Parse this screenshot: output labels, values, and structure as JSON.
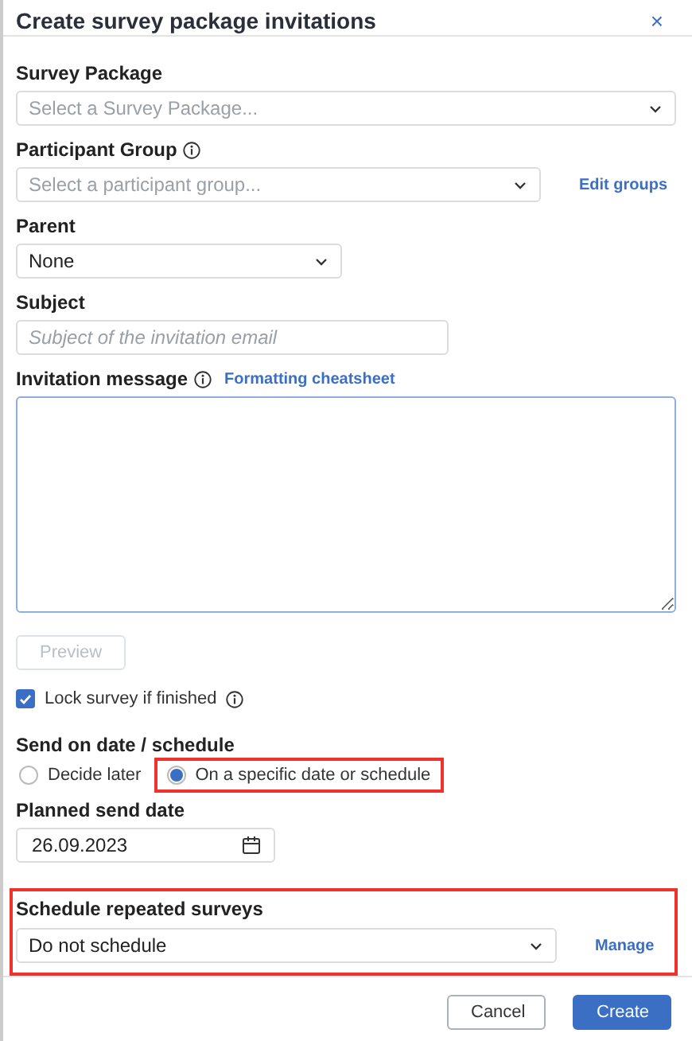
{
  "dialog": {
    "title": "Create survey package invitations",
    "close": "×"
  },
  "survey_package": {
    "label": "Survey Package",
    "placeholder": "Select a Survey Package..."
  },
  "participant_group": {
    "label": "Participant Group",
    "placeholder": "Select a participant group...",
    "link": "Edit groups"
  },
  "parent": {
    "label": "Parent",
    "value": "None"
  },
  "subject": {
    "label": "Subject",
    "placeholder": "Subject of the invitation email"
  },
  "invitation_message": {
    "label": "Invitation message",
    "link": "Formatting cheatsheet"
  },
  "preview_button": {
    "label": "Preview",
    "disabled": true
  },
  "lock_survey": {
    "label": "Lock survey if finished",
    "checked": true
  },
  "send_on": {
    "label": "Send on date / schedule",
    "options": [
      {
        "label": "Decide later",
        "selected": false,
        "highlighted": false
      },
      {
        "label": "On a specific date or schedule",
        "selected": true,
        "highlighted": true
      }
    ]
  },
  "planned_send_date": {
    "label": "Planned send date",
    "value": "26.09.2023"
  },
  "schedule": {
    "label": "Schedule repeated surveys",
    "value": "Do not schedule",
    "link": "Manage",
    "highlighted": true
  },
  "buttons": [
    {
      "label": "Cancel",
      "kind": "secondary"
    },
    {
      "label": "Create",
      "kind": "primary"
    }
  ]
}
